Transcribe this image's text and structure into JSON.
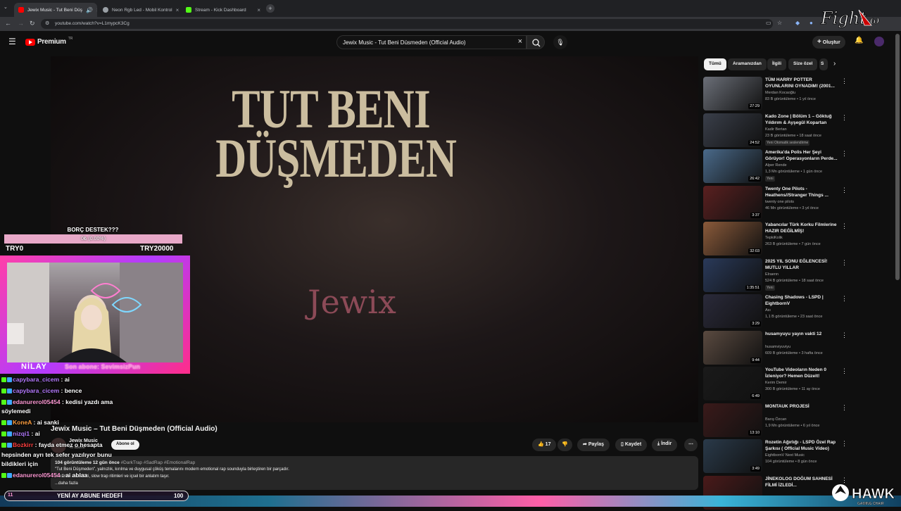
{
  "browser": {
    "tabs": [
      {
        "label": "Jewix Music - Tut Beni Düş",
        "active": true,
        "color": "#ff0000"
      },
      {
        "label": "Neon Rgb Led - Mobil Kontrol",
        "active": false,
        "color": "#9aa0a6"
      },
      {
        "label": "Stream - Kick Dashboard",
        "active": false,
        "color": "#53fc18"
      }
    ],
    "url": "youtube.com/watch?v=L1mypcK3Cg"
  },
  "youtube": {
    "logo": "Premium",
    "logo_sup": "TR",
    "search_value": "Jewix Music - Tut Beni Düsmeden (Official Audio)",
    "create_label": "Oluştur",
    "video_art_title": "TUT BENI DÜŞMEDEN",
    "video_art_artist": "Jewix",
    "video_title": "Jewix Music – Tut Beni Düşmeden (Official Audio)",
    "channel": "Jewix Music",
    "subscribers": "40 abone",
    "subscribe_label": "Abone ol",
    "likes": "17",
    "share_label": "Paylaş",
    "save_label": "Kaydet",
    "download_label": "İndir",
    "desc_stats": "104 görüntüleme  12 gün önce",
    "desc_tags": "#DarkTrap #SadRap #EmotionalRap",
    "desc_line1": "\"Tut Beni Düşmeden\", yalnızlık, kırılma ve duygusal çöküş temalarını modern emotional rap sounduyla birleştiren bir parçadır.",
    "desc_line2": "Karanlık atmosferi, slow trap ritimleri ve içsel bir anlatım taşır.",
    "desc_more": "...daha fazla"
  },
  "chips": [
    "Tümü",
    "Aramanızdan",
    "İlgili",
    "Size özel",
    "S"
  ],
  "recommendations": [
    {
      "title": "TÜM HARRY POTTER OYUNLARINI OYNADIM! (2001...",
      "channel": "Merdan Kocaoğlu",
      "meta": "83 B görüntüleme • 1 yıl önce",
      "duration": "27:29",
      "badge": "",
      "color": "#6b6f78"
    },
    {
      "title": "Kado Zone | Bölüm 1 – Göktuğ Yıldırım & Ayşegül Kopartan",
      "channel": "Kadir Bertan",
      "meta": "23 B görüntüleme • 18 saat önce",
      "duration": "24:52",
      "badge": "Yeni  Otomatik seslendirme",
      "color": "#3a3f4a"
    },
    {
      "title": "Amerika'da Polis Her Şeyi Görüyor! Operasyonların Perde...",
      "channel": "Alper Rende",
      "meta": "1,3 Mn görüntüleme • 1 gün önce",
      "duration": "26:42",
      "badge": "Yeni",
      "color": "#4a6a8a"
    },
    {
      "title": "Twenty One Pilots - Heathens//Stranger Things ...",
      "channel": "twenty one pilots",
      "meta": "46 Mn görüntüleme • 3 yıl önce",
      "duration": "3:37",
      "badge": "",
      "color": "#5a2020"
    },
    {
      "title": "Yabancılar Türk Korku Filmlerine HAZIR DEĞİLMİŞ!",
      "channel": "TepkiKolik",
      "meta": "263 B görüntüleme • 7 gün önce",
      "duration": "32:03",
      "badge": "",
      "color": "#8a5a3a"
    },
    {
      "title": "2025 YIL SONU EĞLENCESİ! MUTLU YILLAR",
      "channel": "Elraenn",
      "meta": "524 B görüntüleme • 18 saat önce",
      "duration": "1:35:51",
      "badge": "Yeni",
      "color": "#2a3a5a"
    },
    {
      "title": "Chasing Shadows - LSPD | EightbornV",
      "channel": "Ası",
      "meta": "1,1 B görüntüleme • 23 saat önce",
      "duration": "3:29",
      "badge": "",
      "color": "#2a2a3a"
    },
    {
      "title": "husamyuyu yayın vakti 12",
      "channel": "husamviyuviyu",
      "meta": "609 B görüntüleme • 3 hafta önce",
      "duration": "9:44",
      "badge": "",
      "color": "#5a4a40"
    },
    {
      "title": "YouTube Videoların Neden 0 İzleniyor? Hemen Düzelt!",
      "channel": "Kerim Demir",
      "meta": "300 B görüntüleme • 11 ay önce",
      "duration": "6:49",
      "badge": "",
      "color": "#1a1a1a"
    },
    {
      "title": "MONTAUK PROJESİ",
      "channel": "Barış Özcan",
      "meta": "1,9 Mn görüntüleme • 6 yıl önce",
      "duration": "13:10",
      "badge": "",
      "color": "#3a1a1a"
    },
    {
      "title": "Rozetin Ağırlığı - LSPD Özel Rap Şarkısı ( Official Music Video)",
      "channel": "EightbornV Next Music",
      "meta": "104 görüntüleme • 8 gün önce",
      "duration": "3:49",
      "badge": "",
      "color": "#2a3a4a"
    },
    {
      "title": "JİNEKOLOG DOĞUM SAHNESİ FİLMİ İZLEDİ...",
      "channel": "",
      "meta": "",
      "duration": "",
      "badge": "",
      "color": "#4a1a1a"
    }
  ],
  "overlay": {
    "goal_title": "BORÇ DESTEK???",
    "goal_pct": "0₺ (0.00%)",
    "goal_fraction": 0.0,
    "goal_min": "TRY0",
    "goal_max": "TRY20000",
    "cam_name": "NİLAY",
    "last_sub": "Son abone: SevimsizPun",
    "chat": [
      {
        "user": "capybara_cicem",
        "msg": "ai",
        "color": "#b57bff"
      },
      {
        "user": "capybara_cicem",
        "msg": "bence",
        "color": "#b57bff"
      },
      {
        "user": "edanurerol05454",
        "msg": "kedisi yazdı ama",
        "color": "#ff9ad5"
      },
      {
        "user": "",
        "msg": "söylemedi",
        "color": "#ffffff"
      },
      {
        "user": "KoneA",
        "msg": "ai sanki",
        "color": "#ff9f40"
      },
      {
        "user": "nizqi1",
        "msg": "ai",
        "color": "#b57bff"
      },
      {
        "user": "Bozkirr",
        "msg": "fayda etmez o hesapta",
        "color": "#ff4040"
      },
      {
        "user": "",
        "msg": "hepsinden ayrı tek sefer yazılıyor bunu",
        "color": "#ffffff"
      },
      {
        "user": "",
        "msg": "bildikleri için",
        "color": "#ffffff"
      },
      {
        "user": "edanurerol05454",
        "msg": "ai ablaa",
        "color": "#ff9ad5"
      }
    ],
    "sub_goal_label": "YENİ AY ABUNE HEDEFİ",
    "sub_goal_current": "11",
    "sub_goal_target": "100",
    "brand": "HAWK",
    "brand_sub": "GAMING CHAIR",
    "corner_logo": "Fight"
  }
}
